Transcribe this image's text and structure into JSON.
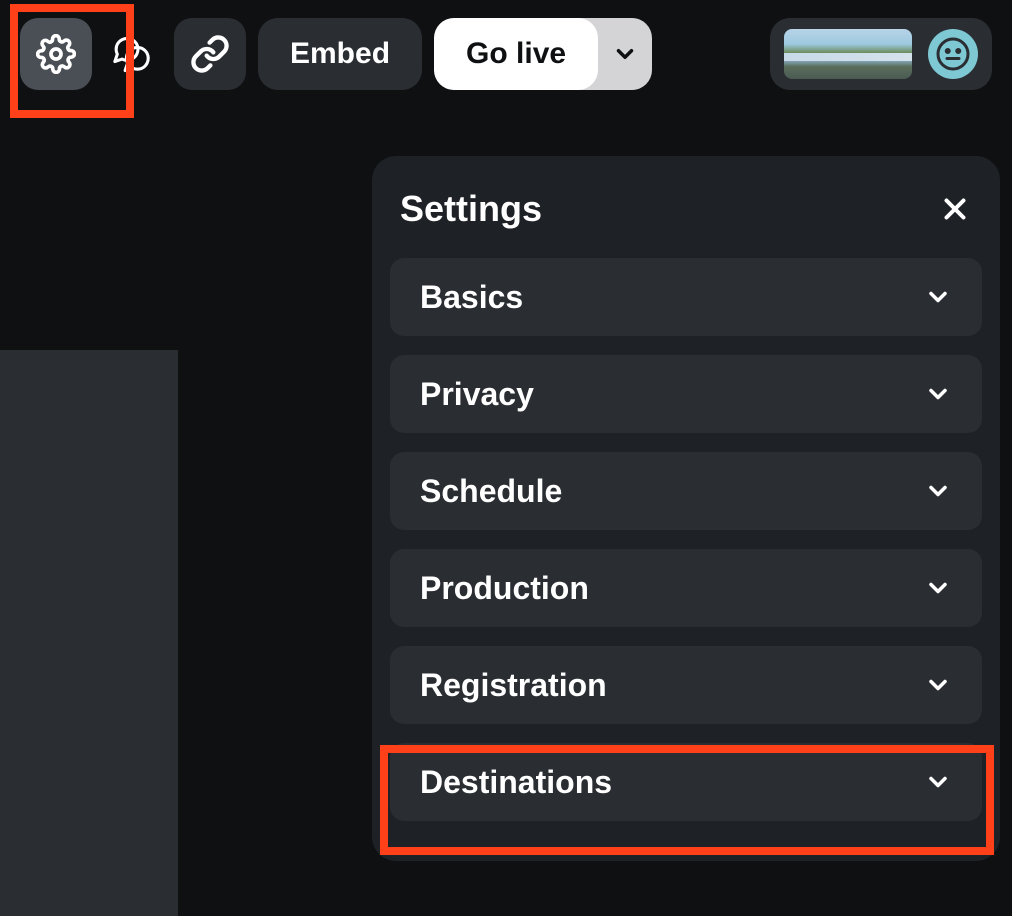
{
  "toolbar": {
    "embed_label": "Embed",
    "golive_label": "Go live"
  },
  "panel": {
    "title": "Settings",
    "items": [
      {
        "label": "Basics"
      },
      {
        "label": "Privacy"
      },
      {
        "label": "Schedule"
      },
      {
        "label": "Production"
      },
      {
        "label": "Registration"
      },
      {
        "label": "Destinations"
      }
    ]
  }
}
